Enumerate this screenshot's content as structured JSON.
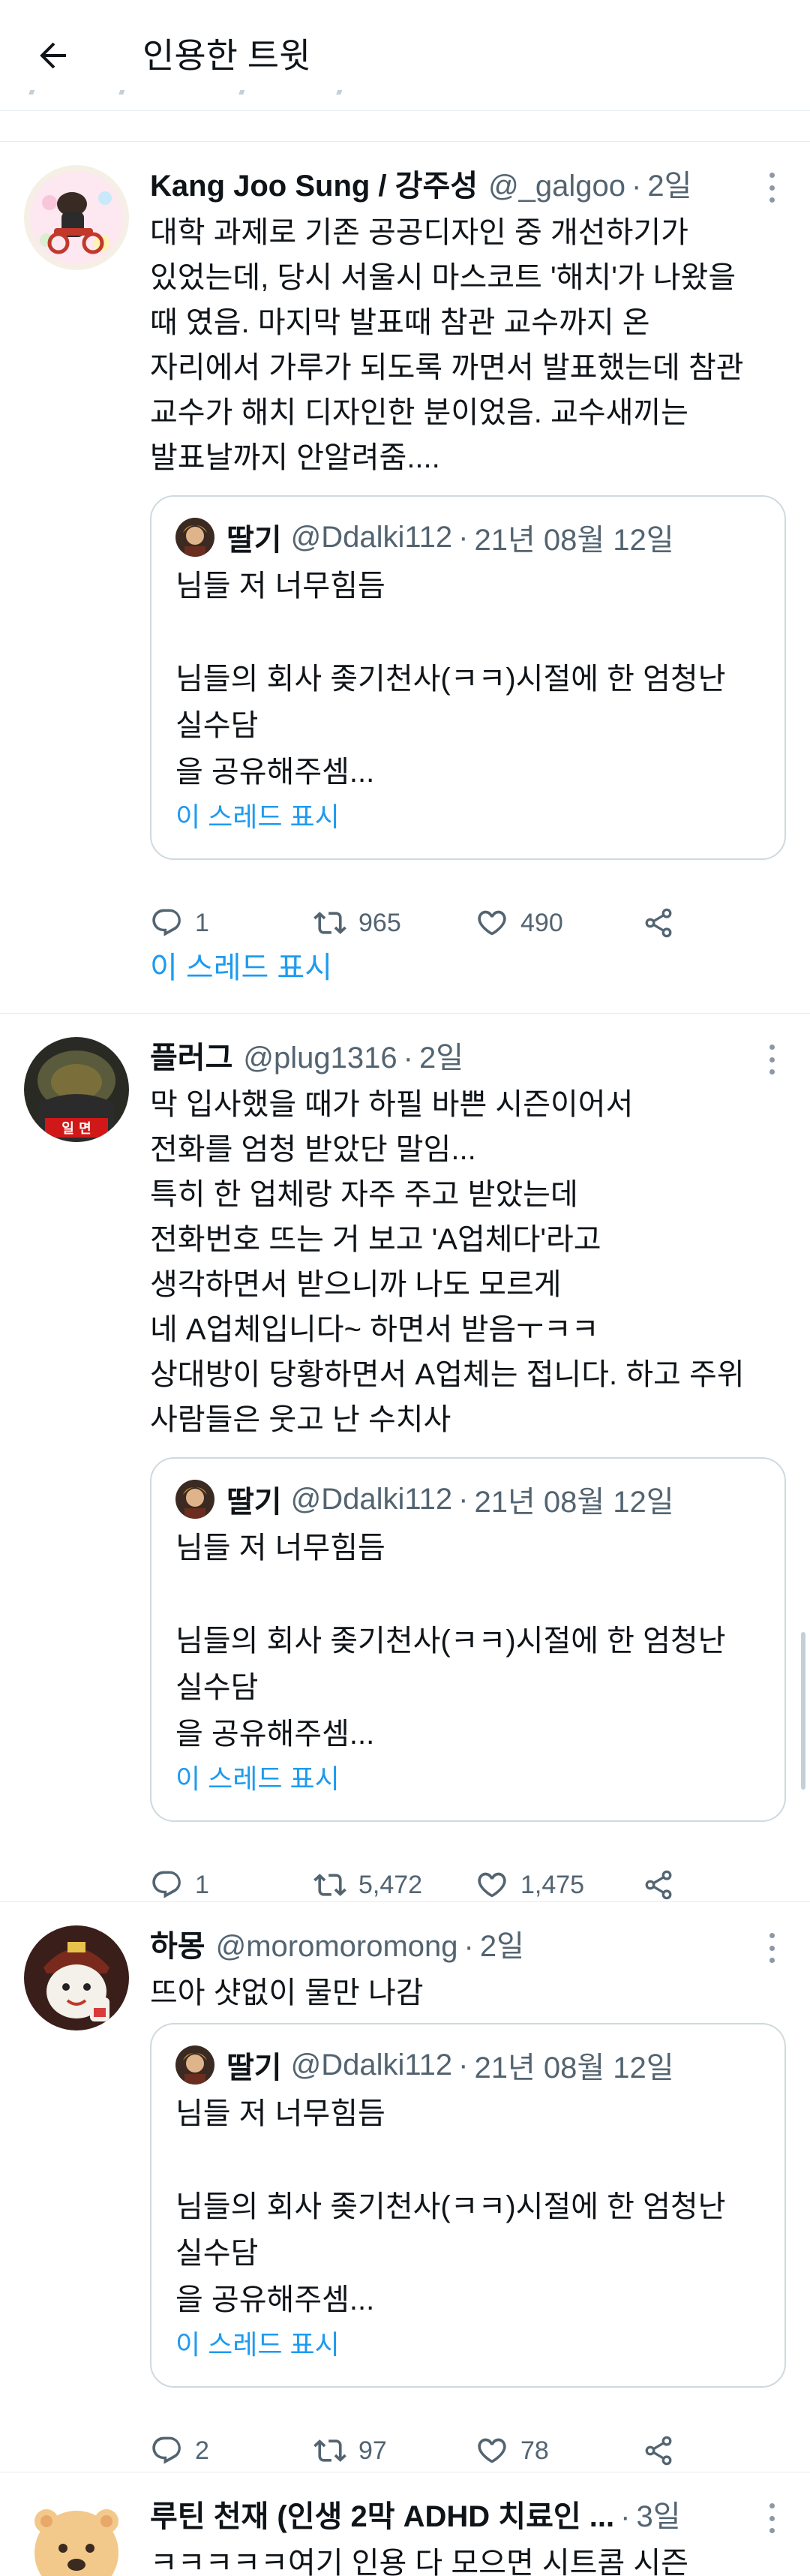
{
  "header": {
    "title": "인용한 트윗",
    "back_icon": "arrow-left-icon"
  },
  "quoted_tweet": {
    "name": "딸기",
    "handle": "@Ddalki112",
    "sep": "·",
    "time": "21년 08월 12일",
    "lines": [
      "님들 저 너무힘듬",
      "",
      "님들의 회사 좆기천사(ㅋㅋ)시절에 한 엄청난",
      "실수담",
      "을 공유해주셈..."
    ],
    "thread_link": "이 스레드 표시"
  },
  "tweets": [
    {
      "name": "Kang Joo Sung / 강주성",
      "handle": "@_galgoo",
      "sep": "·",
      "time": "2일",
      "lines": [
        "대학 과제로 기존 공공디자인 중 개선하기가",
        "있었는데, 당시 서울시 마스코트 '해치'가 나왔을",
        "때 였음. 마지막 발표때 참관 교수까지 온",
        "자리에서 가루가 되도록 까면서 발표했는데 참관",
        "교수가 해치 디자인한 분이었음. 교수새끼는",
        "발표날까지 안알려줌...."
      ],
      "replies": "1",
      "retweets": "965",
      "likes": "490",
      "show_thread": "이 스레드 표시"
    },
    {
      "name": "플러그",
      "handle": "@plug1316",
      "sep": "·",
      "time": "2일",
      "avatar_text": "일 면",
      "lines": [
        "막 입사했을 때가 하필 바쁜 시즌이어서",
        "전화를 엄청 받았단 말임...",
        "특히 한 업체랑 자주 주고 받았는데",
        "전화번호 뜨는 거 보고 'A업체다'라고",
        "생각하면서 받으니까 나도 모르게",
        "네 A업체입니다~ 하면서 받음ㅜㅋㅋ",
        "상대방이 당황하면서 A업체는 접니다. 하고 주위",
        "사람들은 웃고 난 수치사"
      ],
      "replies": "1",
      "retweets": "5,472",
      "likes": "1,475"
    },
    {
      "name": "하몽",
      "handle": "@moromoromong",
      "sep": "·",
      "time": "2일",
      "lines": [
        "뜨아 샷없이 물만 나감"
      ],
      "replies": "2",
      "retweets": "97",
      "likes": "78"
    },
    {
      "name": "루틴 천재 (인생 2막 ADHD 치료인 ...",
      "sep": "·",
      "time": "3일",
      "lines": [
        "ㅋㅋㅋㅋㅋ여기 인용 다 모으면 시트콤 시즌"
      ]
    }
  ],
  "icons": {
    "reply": "reply-icon",
    "retweet": "retweet-icon",
    "like": "heart-icon",
    "share": "share-icon",
    "more": "more-icon"
  },
  "colors": {
    "link": "#1d9bf0",
    "secondary": "#536471",
    "border": "#cfd9de",
    "divider": "#e6ecf0"
  }
}
